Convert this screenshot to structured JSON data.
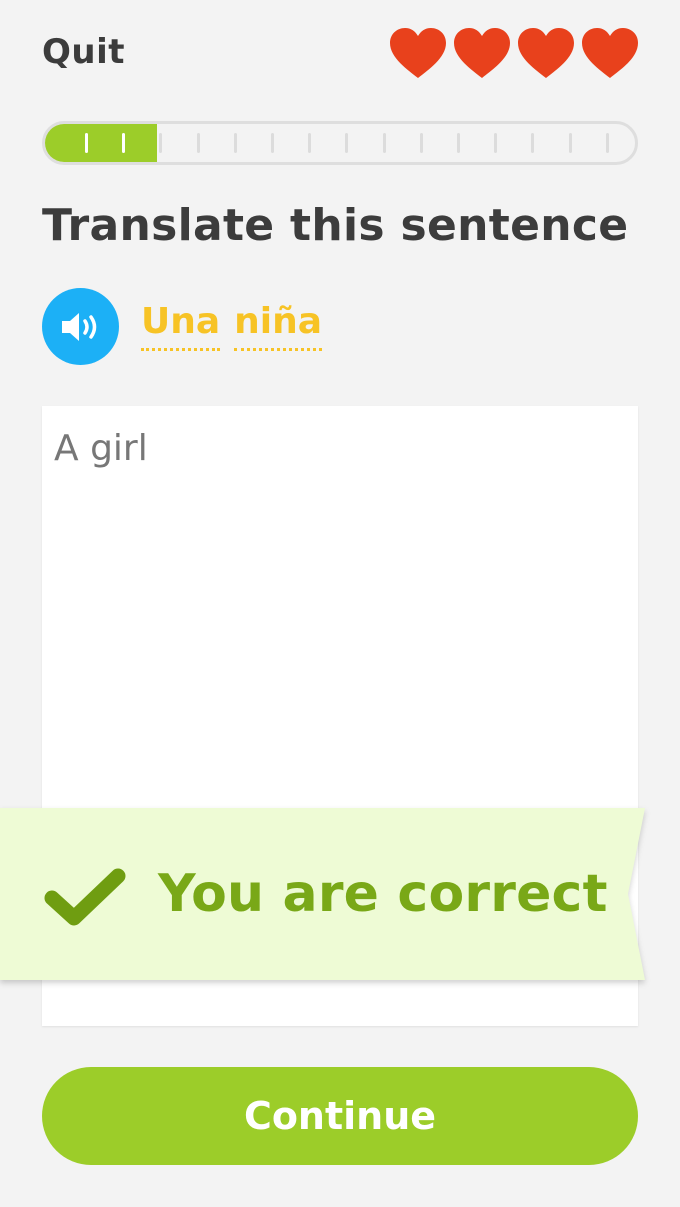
{
  "header": {
    "quit_label": "Quit",
    "hearts": 4,
    "heart_color": "#e8411c"
  },
  "progress": {
    "fraction": 0.19,
    "fill_color": "#9ccd29",
    "completed_ticks": 2,
    "total_ticks": 15
  },
  "instruction": "Translate this sentence",
  "prompt": {
    "audio_icon": "speaker-icon",
    "words": [
      "Una",
      "niña"
    ]
  },
  "answer": {
    "value": "A girl"
  },
  "feedback": {
    "icon": "checkmark-icon",
    "message": "You are correct",
    "background": "#eefbd5",
    "text_color": "#79a817"
  },
  "footer": {
    "continue_label": "Continue",
    "button_color": "#9ccd29"
  }
}
